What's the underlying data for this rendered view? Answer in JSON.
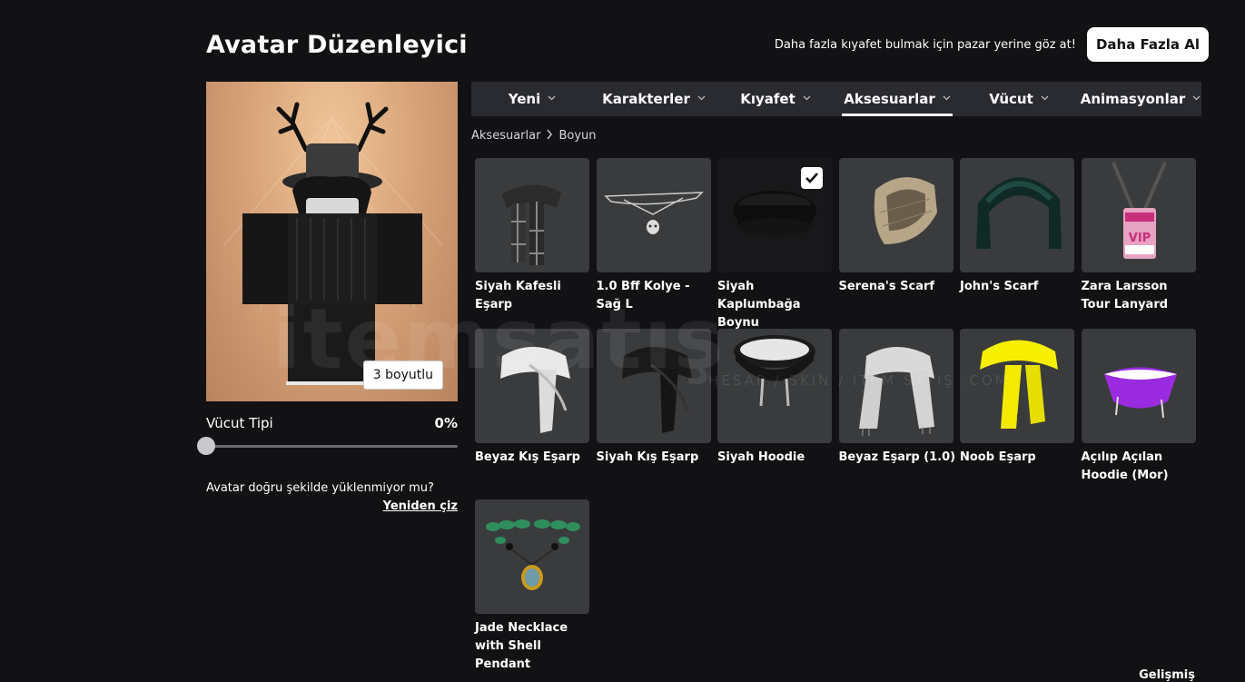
{
  "header": {
    "title": "Avatar Düzenleyici",
    "promo_text": "Daha fazla kıyafet bulmak için pazar yerine göz at!",
    "promo_button": "Daha Fazla Al"
  },
  "avatar_panel": {
    "view_3d_button": "3 boyutlu",
    "body_type_label": "Vücut Tipi",
    "body_type_value": "0%",
    "body_type_level": 0,
    "help_text": "Avatar doğru şekilde yüklenmiyor mu?",
    "redraw_link": "Yeniden çiz"
  },
  "tabs": [
    {
      "label": "Yeni",
      "active": false
    },
    {
      "label": "Karakterler",
      "active": false
    },
    {
      "label": "Kıyafet",
      "active": false
    },
    {
      "label": "Aksesuarlar",
      "active": true
    },
    {
      "label": "Vücut",
      "active": false
    },
    {
      "label": "Animasyonlar",
      "active": false
    }
  ],
  "breadcrumb": [
    "Aksesuarlar",
    "Boyun"
  ],
  "items": [
    {
      "name": "Siyah Kafesli Eşarp",
      "icon": "plaid-scarf",
      "selected": false
    },
    {
      "name": "1.0 Bff Kolye - Sağ L",
      "icon": "skull-necklace",
      "selected": false
    },
    {
      "name": "Siyah Kaplumbağa Boynu",
      "icon": "turtleneck",
      "selected": true
    },
    {
      "name": "Serena's Scarf",
      "icon": "beige-scarf",
      "selected": false
    },
    {
      "name": "John's Scarf",
      "icon": "green-scarf",
      "selected": false
    },
    {
      "name": "Zara Larsson Tour Lanyard",
      "icon": "vip-lanyard",
      "selected": false
    },
    {
      "name": "Beyaz Kış Eşarp",
      "icon": "white-winter-scarf",
      "selected": false
    },
    {
      "name": "Siyah Kış Eşarp",
      "icon": "black-winter-scarf",
      "selected": false
    },
    {
      "name": "Siyah Hoodie",
      "icon": "hoodie",
      "selected": false
    },
    {
      "name": "Beyaz Eşarp (1.0)",
      "icon": "white-scarf",
      "selected": false
    },
    {
      "name": "Noob Eşarp",
      "icon": "yellow-scarf",
      "selected": false
    },
    {
      "name": "Açılıp Açılan Hoodie (Mor)",
      "icon": "purple-hood",
      "selected": false
    },
    {
      "name": "Jade Necklace with Shell Pendant",
      "icon": "jade-necklace",
      "selected": false
    }
  ],
  "footer": {
    "advanced_link": "Gelişmiş"
  },
  "watermark": {
    "main": "itemsatış",
    "sub": "HESAP / SKIN / ITEM SATIŞ .COM"
  },
  "colors": {
    "background": "#121215",
    "tile": "#393b3d",
    "tab_bar": "#2a2b31",
    "accent": "#ffffff"
  }
}
